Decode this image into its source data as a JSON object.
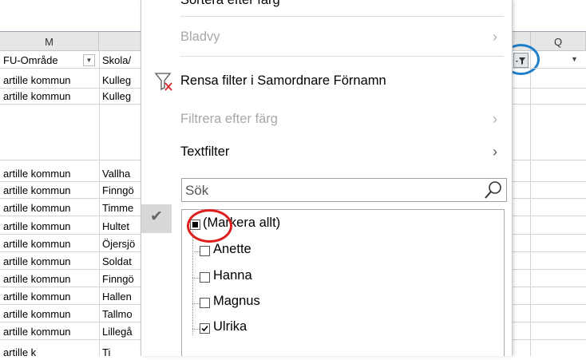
{
  "columns": {
    "m": "M",
    "q": "Q"
  },
  "header_row": {
    "fu_omrade": "FU-Område",
    "skola": "Skola/"
  },
  "rows": [
    {
      "kommun": "artille kommun",
      "skola": "Kulleg"
    },
    {
      "kommun": "artille kommun",
      "skola": "Kulleg"
    },
    {
      "kommun": "artille kommun",
      "skola": "Vallha"
    },
    {
      "kommun": "artille kommun",
      "skola": "Finngö"
    },
    {
      "kommun": "artille kommun",
      "skola": "Timme"
    },
    {
      "kommun": "artille kommun",
      "skola": "Hultet"
    },
    {
      "kommun": "artille kommun",
      "skola": "Öjersjö"
    },
    {
      "kommun": "artille kommun",
      "skola": "Soldat"
    },
    {
      "kommun": "artille kommun",
      "skola": "Finngö"
    },
    {
      "kommun": "artille kommun",
      "skola": "Hallen"
    },
    {
      "kommun": "artille kommun",
      "skola": "Tallmo"
    },
    {
      "kommun": "artille kommun",
      "skola": "Lillegå"
    },
    {
      "kommun": "artille k",
      "skola": "Ti"
    }
  ],
  "menu": {
    "sort_by_color": "Sortera efter färg",
    "sheet_view": "Bladvy",
    "clear_filter": "Rensa filter i Samordnare Förnamn",
    "filter_by_color": "Filtrera efter färg",
    "text_filter": "Textfilter",
    "chevron": "›"
  },
  "search": {
    "placeholder": "Sök"
  },
  "checklist": [
    {
      "label": "(Markera allt)",
      "state": "indeterminate"
    },
    {
      "label": "Anette",
      "state": "unchecked"
    },
    {
      "label": "Hanna",
      "state": "unchecked"
    },
    {
      "label": "Magnus",
      "state": "unchecked"
    },
    {
      "label": "Ulrika",
      "state": "checked"
    }
  ],
  "check_glyph": "✔",
  "dropdown_glyph": "▼",
  "icons": {
    "clear_filter": "clear-filter-icon",
    "search": "search-icon",
    "filter_active": "filter-active-icon",
    "dropdown": "dropdown-arrow-icon",
    "checkmark": "checkmark-icon"
  },
  "colors": {
    "annotation_blue": "#1f7fc9",
    "annotation_red": "#e01e1e",
    "clear_filter_x": "#d9262c",
    "disabled_text": "#a8a8a8"
  }
}
